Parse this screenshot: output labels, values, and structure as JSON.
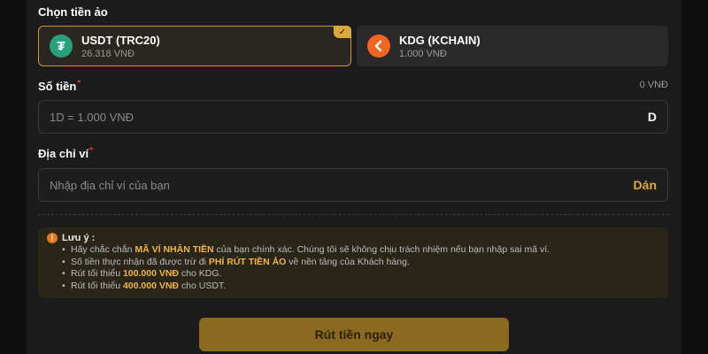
{
  "crypto": {
    "label": "Chọn tiền ảo",
    "options": [
      {
        "name": "USDT (TRC20)",
        "rate": "26.318 VNĐ",
        "icon": "tether-icon",
        "color": "#26a17b",
        "selected": true
      },
      {
        "name": "KDG (KCHAIN)",
        "rate": "1.000 VNĐ",
        "icon": "kchain-icon",
        "color": "#f26522",
        "selected": false
      }
    ]
  },
  "amount": {
    "label": "Số tiền",
    "required_mark": "*",
    "balance": "0 VNĐ",
    "placeholder": "1D = 1.000 VNĐ",
    "suffix": "D"
  },
  "wallet": {
    "label": "Địa chỉ ví",
    "required_mark": "*",
    "placeholder": "Nhập địa chỉ ví của bạn",
    "paste_label": "Dán"
  },
  "notes": {
    "title": "Lưu ý :",
    "items": [
      {
        "before": "Hãy chắc chắn ",
        "highlight": "MÃ VÍ NHẬN TIỀN",
        "after": " của bạn chính xác. Chúng tôi sẽ không chịu trách nhiệm nếu bạn nhập sai mã ví."
      },
      {
        "before": "Số tiền thực nhận đã được trừ đi ",
        "highlight": "PHÍ RÚT TIỀN ẢO",
        "after": " về nền tảng của Khách hàng."
      },
      {
        "before": "Rút tối thiểu ",
        "highlight": "100.000 VNĐ",
        "after": " cho KDG."
      },
      {
        "before": "Rút tối thiểu ",
        "highlight": "400.000 VNĐ",
        "after": " cho USDT."
      }
    ]
  },
  "submit_label": "Rút tiền ngay",
  "colors": {
    "accent": "#e0a935",
    "selected_border": "#c89b2c",
    "button": "#8a6a20"
  }
}
